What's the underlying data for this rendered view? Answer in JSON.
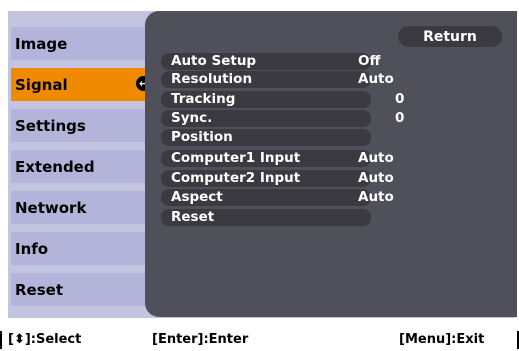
{
  "sidebar": {
    "items": [
      {
        "label": "Image"
      },
      {
        "label": "Signal"
      },
      {
        "label": "Settings"
      },
      {
        "label": "Extended"
      },
      {
        "label": "Network"
      },
      {
        "label": "Info"
      },
      {
        "label": "Reset"
      }
    ],
    "active_index": 1,
    "enter_icon": "enter-return-icon"
  },
  "panel": {
    "return_label": "Return",
    "rows": [
      {
        "label": "Auto Setup",
        "value": "Off"
      },
      {
        "label": "Resolution",
        "value": "Auto"
      },
      {
        "label": "Tracking",
        "value": "0"
      },
      {
        "label": "Sync.",
        "value": "0"
      },
      {
        "label": "Position",
        "value": ""
      },
      {
        "label": "Computer1 Input",
        "value": "Auto"
      },
      {
        "label": "Computer2 Input",
        "value": "Auto"
      },
      {
        "label": "Aspect",
        "value": "Auto"
      },
      {
        "label": "Reset",
        "value": ""
      }
    ]
  },
  "footer": {
    "select_hint": "[⬍]:Select",
    "enter_hint": "[Enter]:Enter",
    "exit_hint": "[Menu]:Exit"
  },
  "colors": {
    "active_tab": "#f08a00",
    "panel_bg": "#50505a",
    "sidebar_bg": "#c2c4e0"
  }
}
